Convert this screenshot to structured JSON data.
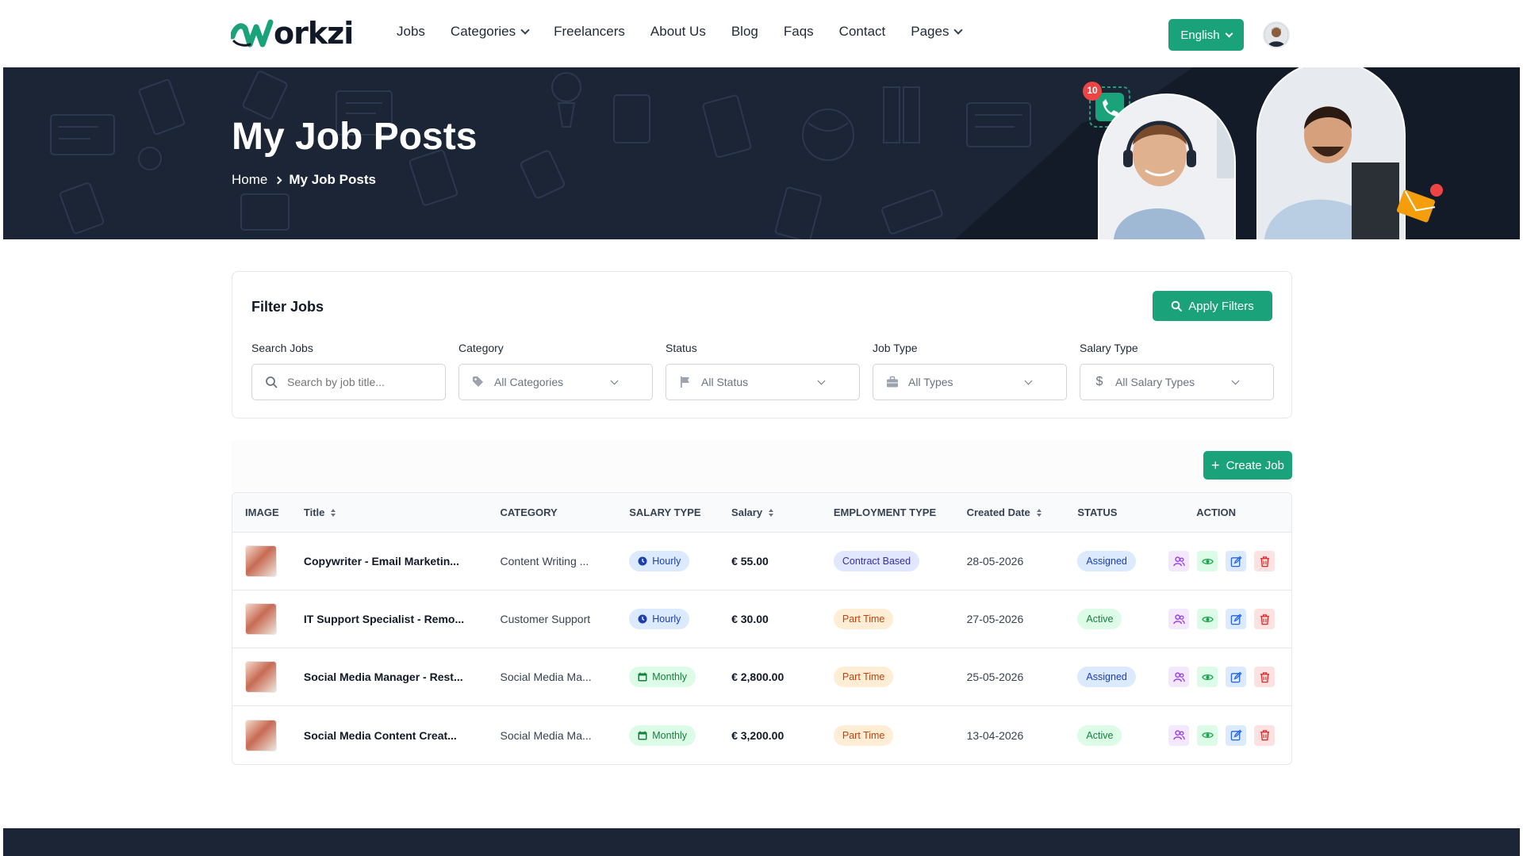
{
  "brand": {
    "logo_text": "orkzi",
    "accent": "#1aa37a",
    "dark": "#1c2536"
  },
  "nav": [
    {
      "label": "Jobs",
      "dropdown": false
    },
    {
      "label": "Categories",
      "dropdown": true
    },
    {
      "label": "Freelancers",
      "dropdown": false
    },
    {
      "label": "About Us",
      "dropdown": false
    },
    {
      "label": "Blog",
      "dropdown": false
    },
    {
      "label": "Faqs",
      "dropdown": false
    },
    {
      "label": "Contact",
      "dropdown": false
    },
    {
      "label": "Pages",
      "dropdown": true
    }
  ],
  "header": {
    "language": "English"
  },
  "hero": {
    "title": "My Job Posts",
    "breadcrumb": {
      "home": "Home",
      "current": "My Job Posts"
    },
    "notification_count": "10"
  },
  "filters": {
    "title": "Filter Jobs",
    "apply_label": "Apply Filters",
    "search": {
      "label": "Search Jobs",
      "placeholder": "Search by job title..."
    },
    "category": {
      "label": "Category",
      "value": "All Categories",
      "icon": "tag-icon"
    },
    "status": {
      "label": "Status",
      "value": "All Status",
      "icon": "flag-icon"
    },
    "job_type": {
      "label": "Job Type",
      "value": "All Types",
      "icon": "briefcase-icon"
    },
    "salary_type": {
      "label": "Salary Type",
      "value": "All Salary Types",
      "icon": "dollar-icon"
    }
  },
  "table": {
    "create_label": "Create Job",
    "headers": {
      "image": "IMAGE",
      "title": "Title",
      "category": "CATEGORY",
      "salary_type": "SALARY TYPE",
      "salary": "Salary",
      "employment_type": "EMPLOYMENT TYPE",
      "created_date": "Created Date",
      "status": "STATUS",
      "action": "ACTION"
    },
    "rows": [
      {
        "title": "Copywriter - Email Marketin...",
        "category": "Content Writing ...",
        "salary_type": "Hourly",
        "salary": "€ 55.00",
        "employment_type": "Contract Based",
        "created_date": "28-05-2026",
        "status": "Assigned"
      },
      {
        "title": "IT Support Specialist - Remo...",
        "category": "Customer Support",
        "salary_type": "Hourly",
        "salary": "€ 30.00",
        "employment_type": "Part Time",
        "created_date": "27-05-2026",
        "status": "Active"
      },
      {
        "title": "Social Media Manager - Rest...",
        "category": "Social Media Ma...",
        "salary_type": "Monthly",
        "salary": "€ 2,800.00",
        "employment_type": "Part Time",
        "created_date": "25-05-2026",
        "status": "Assigned"
      },
      {
        "title": "Social Media Content Creat...",
        "category": "Social Media Ma...",
        "salary_type": "Monthly",
        "salary": "€ 3,200.00",
        "employment_type": "Part Time",
        "created_date": "13-04-2026",
        "status": "Active"
      }
    ]
  }
}
